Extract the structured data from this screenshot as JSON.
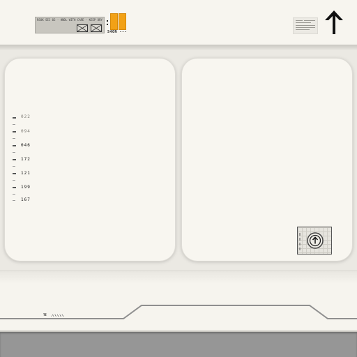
{
  "header": {
    "label_fine_print": "RSOK SEC 02 · HNDL WITH CARE · KEEP DRY · SIDE A UP · LOT 4417 · REF 0098 · SEE MANUAL",
    "orange_code": "S40N ---",
    "notice_icon": "document-icon",
    "top_icon": "up-arrow-icon"
  },
  "scale": {
    "labels": [
      "022",
      "094",
      "046",
      "172",
      "121",
      "199",
      "167"
    ]
  },
  "upload": {
    "icon": "circle-up-arrow-icon"
  },
  "footer": {
    "code": "TE"
  },
  "colors": {
    "accent_orange": "#f2a116",
    "panel": "#f8f6f0",
    "footer_gray": "#969696"
  }
}
